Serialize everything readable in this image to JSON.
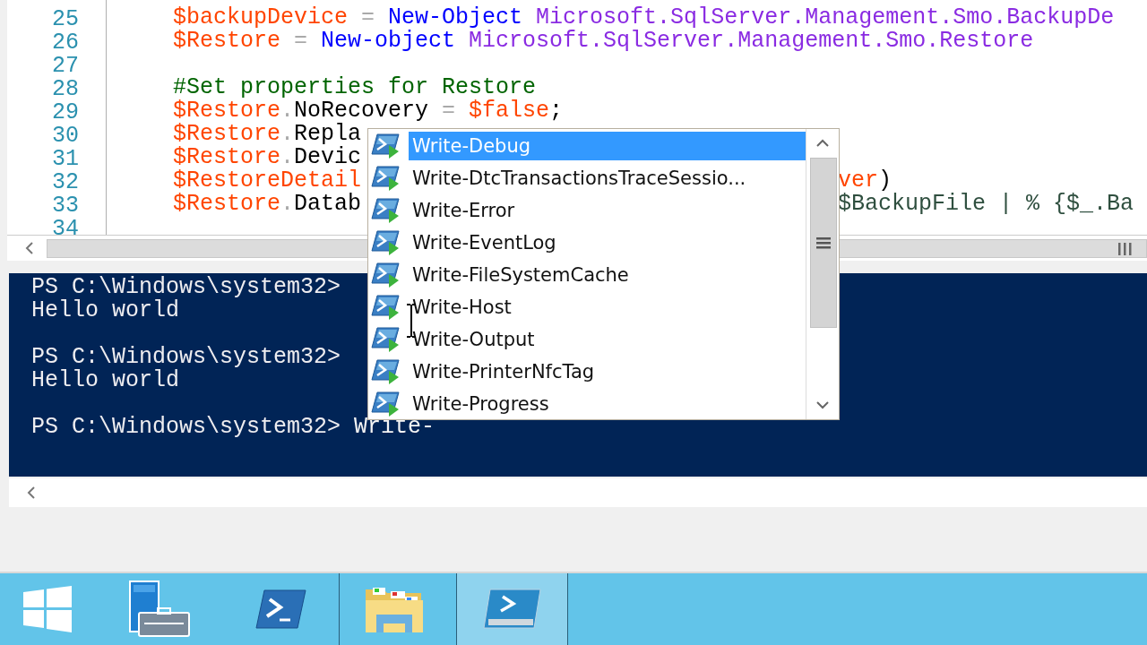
{
  "editor": {
    "lines": [
      {
        "number": "25",
        "tokens": [
          {
            "kind": "variable",
            "text": "$backupDevice"
          },
          {
            "kind": "operator",
            "text": " = "
          },
          {
            "kind": "cmdlet",
            "text": "New-Object"
          },
          {
            "kind": "type",
            "text": " Microsoft.SqlServer.Management.Smo.BackupDe"
          }
        ]
      },
      {
        "number": "26",
        "tokens": [
          {
            "kind": "variable",
            "text": "$Restore"
          },
          {
            "kind": "operator",
            "text": " = "
          },
          {
            "kind": "cmdlet",
            "text": "New-object"
          },
          {
            "kind": "type",
            "text": " Microsoft.SqlServer.Management.Smo.Restore"
          }
        ]
      },
      {
        "number": "27"
      },
      {
        "number": "28",
        "tokens": [
          {
            "kind": "comment",
            "text": "#Set properties for Restore"
          }
        ]
      },
      {
        "number": "29",
        "tokens": [
          {
            "kind": "variable",
            "text": "$Restore"
          },
          {
            "kind": "operator",
            "text": "."
          },
          {
            "kind": "member",
            "text": "NoRecovery"
          },
          {
            "kind": "operator",
            "text": " = "
          },
          {
            "kind": "variable",
            "text": "$false"
          },
          {
            "kind": "member",
            "text": ";"
          }
        ]
      },
      {
        "number": "30",
        "tokens": [
          {
            "kind": "variable",
            "text": "$Restore"
          },
          {
            "kind": "operator",
            "text": "."
          },
          {
            "kind": "member",
            "text": "Repla"
          }
        ]
      },
      {
        "number": "31",
        "tokens": [
          {
            "kind": "variable",
            "text": "$Restore"
          },
          {
            "kind": "operator",
            "text": "."
          },
          {
            "kind": "member",
            "text": "Devic"
          }
        ]
      },
      {
        "number": "32",
        "tokens": [
          {
            "kind": "variable",
            "text": "$RestoreDetail"
          }
        ],
        "tail": [
          {
            "kind": "variable",
            "text": "ver"
          },
          {
            "kind": "member",
            "text": ")"
          }
        ]
      },
      {
        "number": "33",
        "tokens": [
          {
            "kind": "variable",
            "text": "$Restore"
          },
          {
            "kind": "operator",
            "text": "."
          },
          {
            "kind": "member",
            "text": "Datab"
          }
        ],
        "tail": [
          {
            "kind": "argument",
            "text": "$BackupFile | % {$_.Ba"
          }
        ]
      },
      {
        "number": "34"
      }
    ]
  },
  "console": {
    "lines": [
      {
        "kind": "prompt",
        "text": "PS C:\\Windows\\system32>"
      },
      {
        "kind": "output",
        "text": "Hello world"
      },
      {
        "kind": "blank"
      },
      {
        "kind": "prompt",
        "text": "PS C:\\Windows\\system32>"
      },
      {
        "kind": "output",
        "text": "Hello world"
      },
      {
        "kind": "blank"
      },
      {
        "kind": "prompt",
        "text": "PS C:\\Windows\\system32>",
        "input": "Write-"
      }
    ]
  },
  "completion": {
    "items": [
      {
        "label": "Write-Debug",
        "selected": true
      },
      {
        "label": "Write-DtcTransactionsTraceSessio...",
        "selected": false
      },
      {
        "label": "Write-Error",
        "selected": false
      },
      {
        "label": "Write-EventLog",
        "selected": false
      },
      {
        "label": "Write-FileSystemCache",
        "selected": false
      },
      {
        "label": "Write-Host",
        "selected": false
      },
      {
        "label": "Write-Output",
        "selected": false
      },
      {
        "label": "Write-PrinterNfcTag",
        "selected": false
      },
      {
        "label": "Write-Progress",
        "selected": false
      }
    ]
  },
  "taskbar": {
    "items": [
      {
        "kind": "start",
        "selected": false
      },
      {
        "kind": "server",
        "selected": false
      },
      {
        "kind": "shell",
        "selected": false
      },
      {
        "kind": "folder",
        "selected": false
      },
      {
        "kind": "ise",
        "selected": true
      }
    ]
  }
}
